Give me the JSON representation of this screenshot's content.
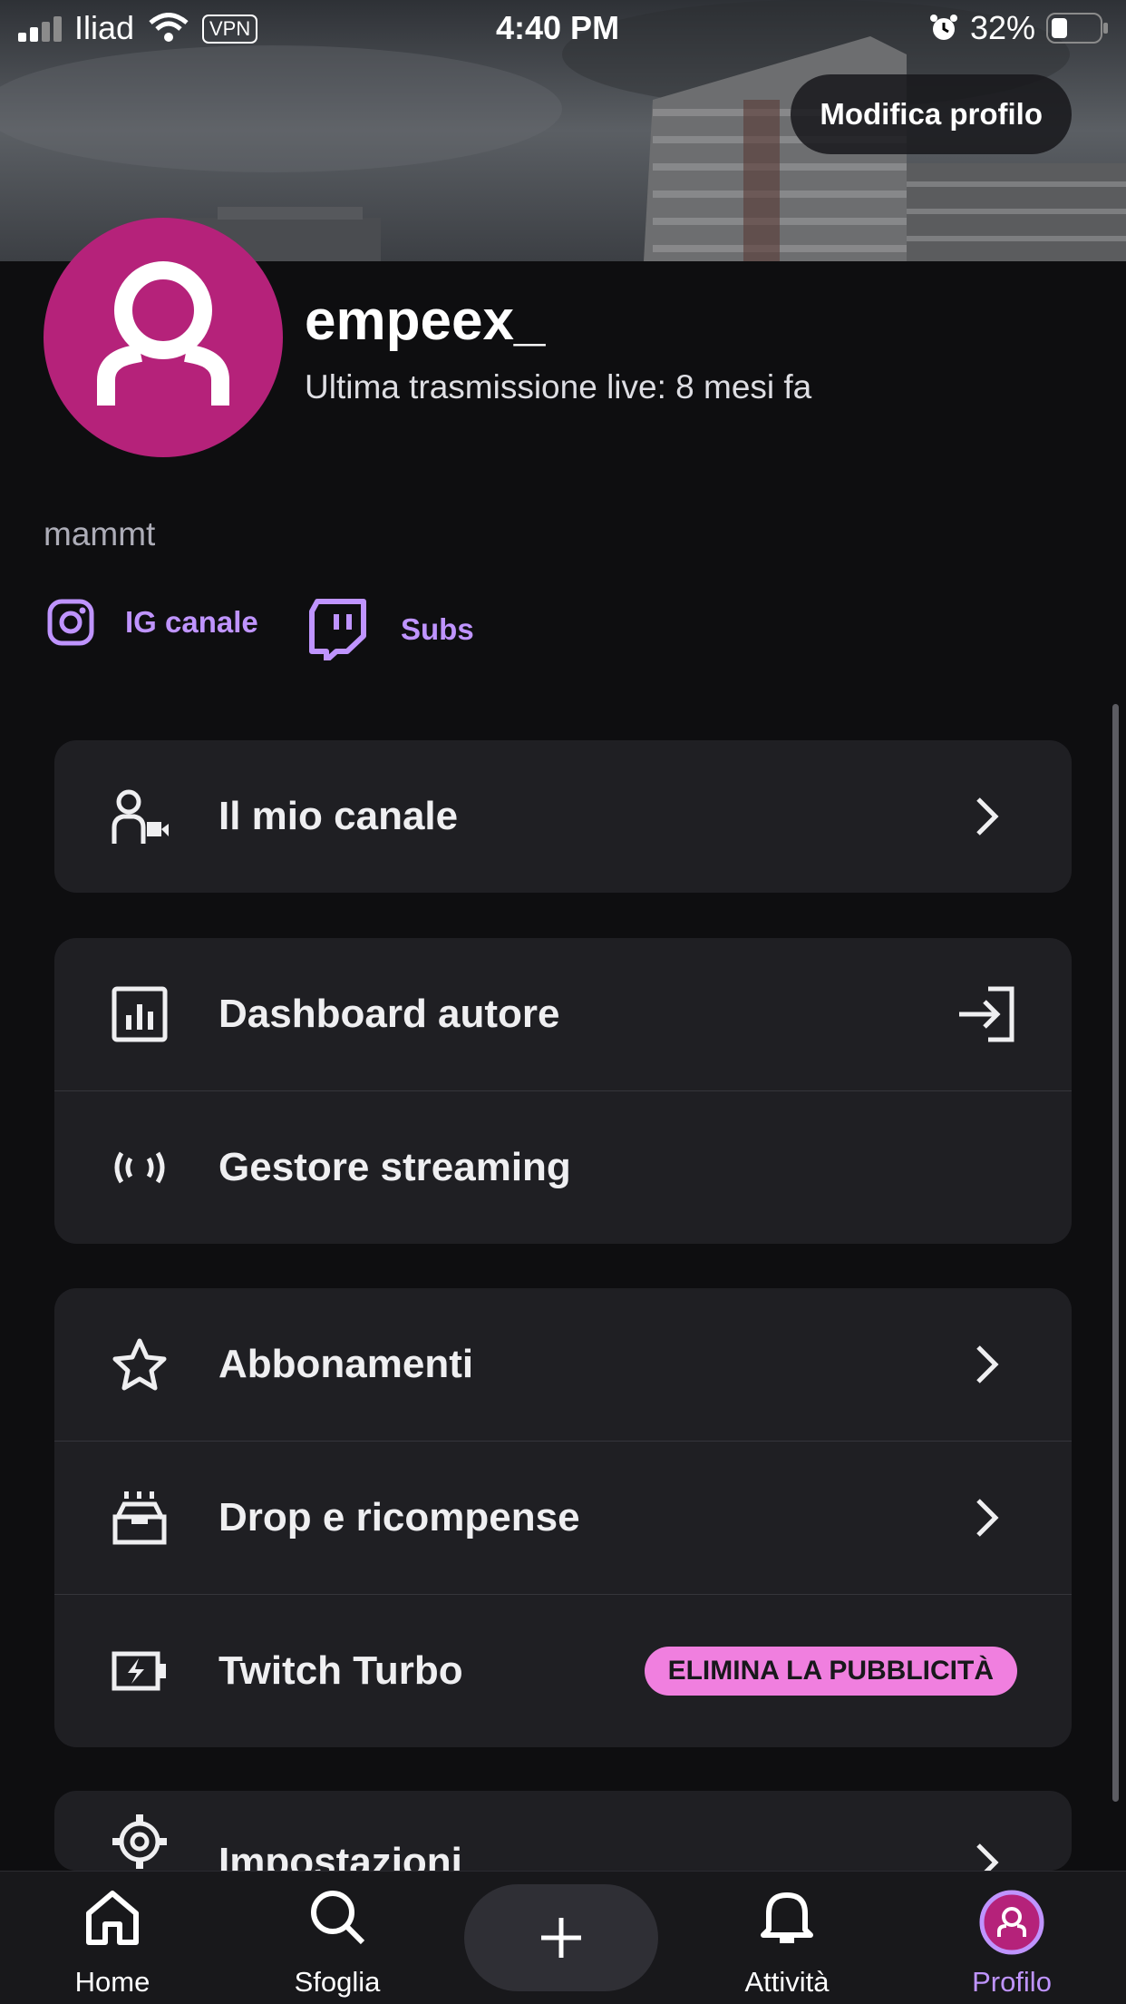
{
  "status_bar": {
    "carrier": "Iliad",
    "vpn": "VPN",
    "time": "4:40 PM",
    "battery": "32%"
  },
  "header": {
    "edit_profile": "Modifica profilo"
  },
  "profile": {
    "username": "empeex_",
    "last_live": "Ultima trasmissione live: 8 mesi fa",
    "bio": "mammt",
    "links": [
      {
        "label": "IG canale",
        "icon": "instagram-icon"
      },
      {
        "label": "Subs",
        "icon": "twitch-icon"
      }
    ]
  },
  "menu": {
    "my_channel": "Il mio canale",
    "creator_dashboard": "Dashboard autore",
    "stream_manager": "Gestore streaming",
    "subscriptions": "Abbonamenti",
    "drops": "Drop e ricompense",
    "turbo": "Twitch Turbo",
    "turbo_badge": "ELIMINA LA PUBBLICITÀ",
    "settings": "Impostazioni"
  },
  "nav": {
    "home": "Home",
    "browse": "Sfoglia",
    "create": "+",
    "activity": "Attività",
    "profile": "Profilo"
  },
  "colors": {
    "background": "#0e0e10",
    "card": "#1f1f23",
    "accent": "#bf94ff",
    "avatar": "#b5227a",
    "badge": "#f07fdf"
  }
}
